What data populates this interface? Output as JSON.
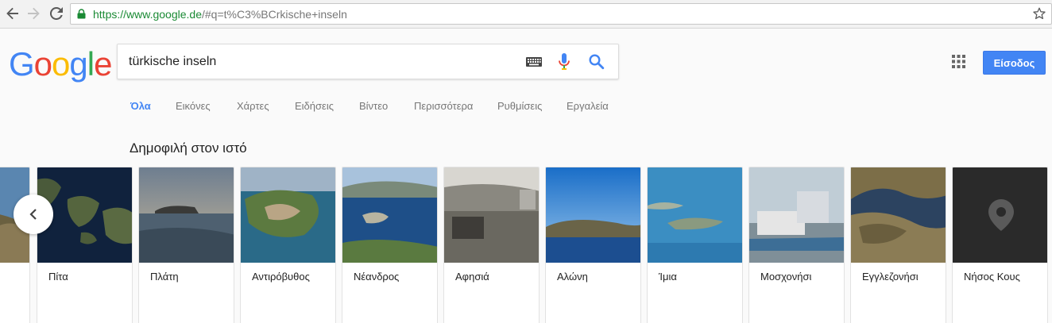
{
  "browser": {
    "url_scheme": "https://",
    "url_host": "www.google.de",
    "url_path": "/#q=t%C3%BCrkische+inseln"
  },
  "header": {
    "logo_text": "Google",
    "search_value": "türkische inseln",
    "signin_label": "Είσοδος"
  },
  "tabs": [
    {
      "label": "Όλα"
    },
    {
      "label": "Εικόνες"
    },
    {
      "label": "Χάρτες"
    },
    {
      "label": "Ειδήσεις"
    },
    {
      "label": "Βίντεο"
    },
    {
      "label": "Περισσότερα"
    },
    {
      "label": "Ρυθμίσεις"
    },
    {
      "label": "Εργαλεία"
    }
  ],
  "carousel": {
    "title": "Δημοφιλή στον ιστό",
    "cards": [
      {
        "label": "Πίτα"
      },
      {
        "label": "Πλάτη"
      },
      {
        "label": "Αντιρόβυθος"
      },
      {
        "label": "Νέανδρος"
      },
      {
        "label": "Αφησιά"
      },
      {
        "label": "Αλώνη"
      },
      {
        "label": "Ίμια"
      },
      {
        "label": "Μοσχονήσι"
      },
      {
        "label": "Εγγλεζονήσι"
      },
      {
        "label": "Νήσος Κους"
      }
    ]
  },
  "colors": {
    "accent_blue": "#4285f4",
    "logo_red": "#ea4335",
    "logo_yellow": "#fbbc05",
    "logo_green": "#34a853"
  },
  "icons": {
    "back": "back-arrow-icon",
    "forward": "forward-arrow-icon",
    "reload": "reload-icon",
    "lock": "lock-icon",
    "bookmark": "star-icon",
    "keyboard": "keyboard-icon",
    "voice": "mic-icon",
    "search": "search-icon",
    "apps": "apps-grid-icon",
    "carousel_prev": "chevron-left-icon",
    "placeholder": "map-pin-icon"
  }
}
